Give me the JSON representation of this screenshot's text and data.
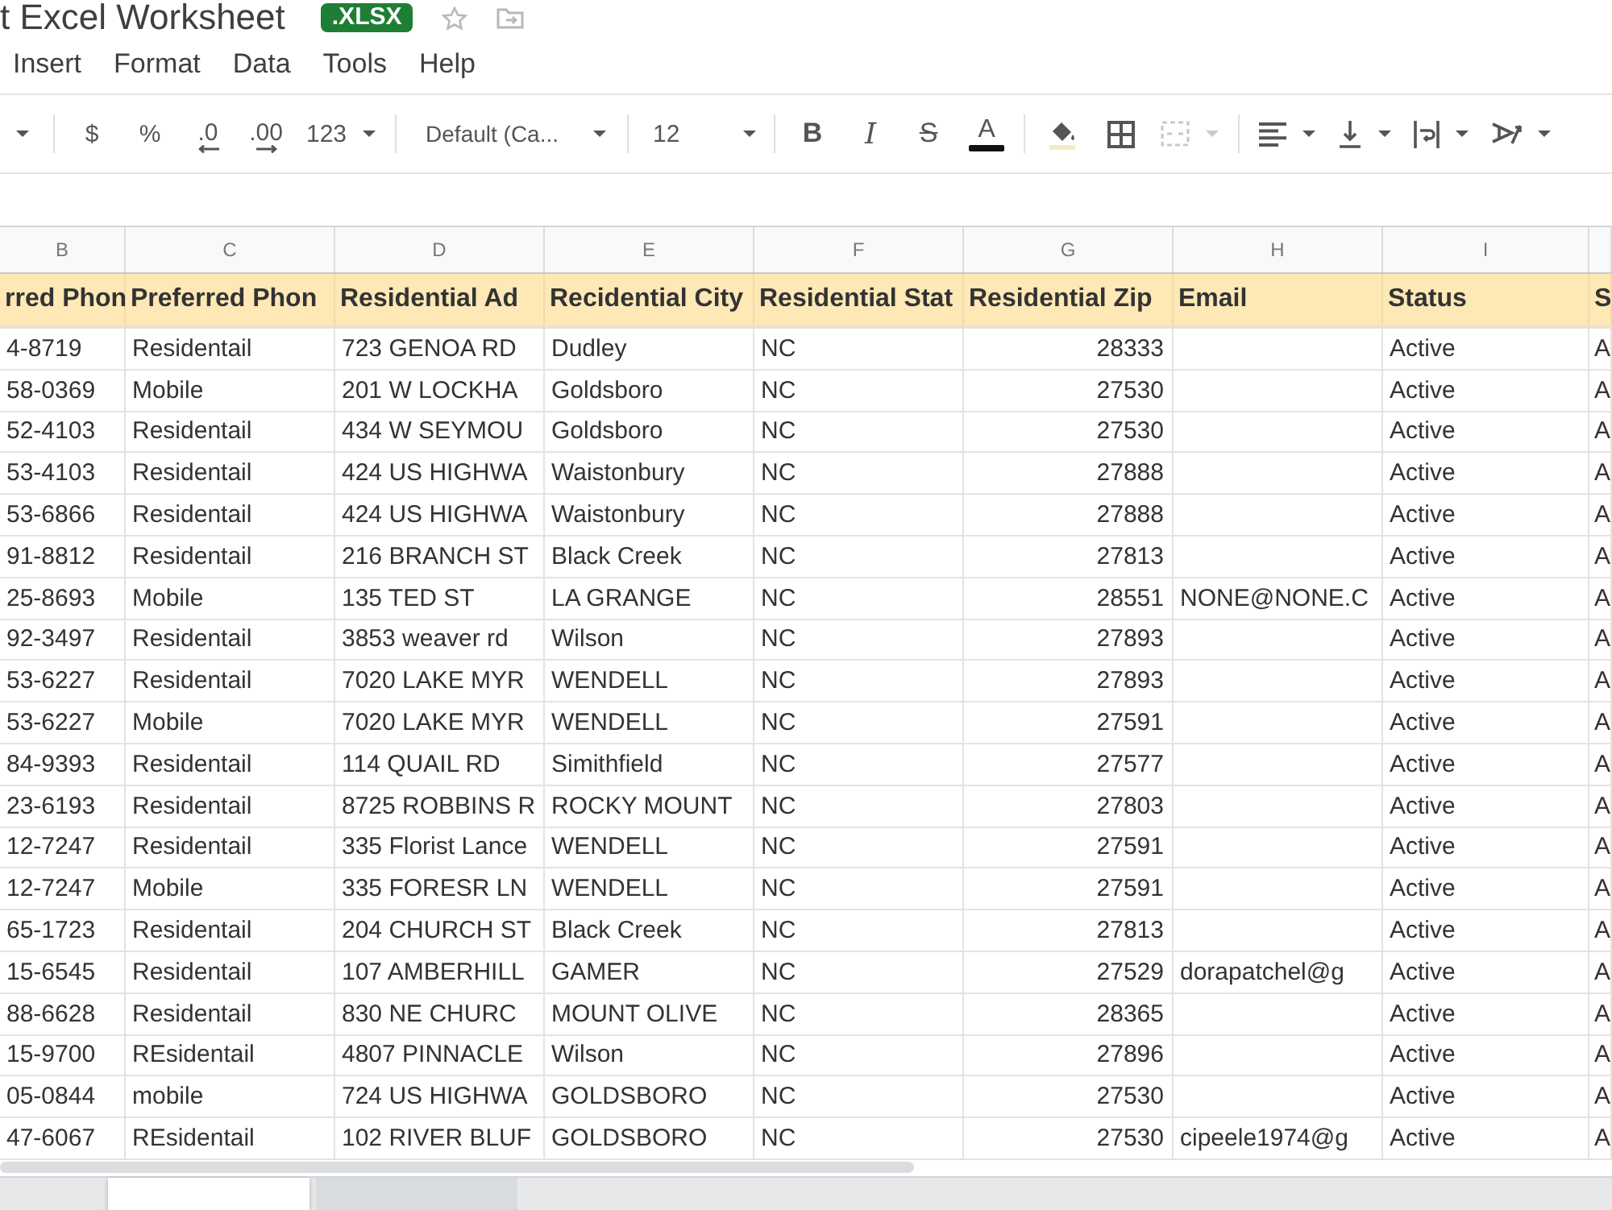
{
  "title": {
    "text": "t Excel Worksheet",
    "badge": ".XLSX"
  },
  "menu": [
    "Insert",
    "Format",
    "Data",
    "Tools",
    "Help"
  ],
  "toolbar": [
    [
      {
        "kind": "caret",
        "menu": true,
        "disabled": false
      }
    ],
    [
      {
        "kind": "text",
        "label": "$",
        "menu": false,
        "disabled": false
      },
      {
        "kind": "text",
        "label": "%",
        "menu": false,
        "disabled": false
      },
      {
        "kind": "decimal-less",
        "label": ".0",
        "menu": false,
        "disabled": false
      },
      {
        "kind": "decimal-more",
        "label": ".00",
        "menu": false,
        "disabled": false
      },
      {
        "kind": "text",
        "label": "123",
        "menu": true,
        "disabled": false
      }
    ],
    [
      {
        "kind": "font",
        "label": "Default (Ca...",
        "menu": true,
        "disabled": false
      }
    ],
    [
      {
        "kind": "size",
        "label": "12",
        "menu": true,
        "disabled": false
      }
    ],
    [
      {
        "kind": "bold",
        "label": "B",
        "menu": false,
        "disabled": false
      },
      {
        "kind": "italic",
        "label": "I",
        "menu": false,
        "disabled": false
      },
      {
        "kind": "strike",
        "label": "S",
        "menu": false,
        "disabled": false
      },
      {
        "kind": "text-color",
        "label": "A",
        "menu": false,
        "disabled": false
      }
    ],
    [
      {
        "kind": "fill",
        "menu": false,
        "disabled": false
      },
      {
        "kind": "borders",
        "menu": false,
        "disabled": false
      },
      {
        "kind": "merge",
        "menu": true,
        "disabled": true
      }
    ],
    [
      {
        "kind": "align",
        "menu": true,
        "disabled": false
      },
      {
        "kind": "valign",
        "menu": true,
        "disabled": false
      },
      {
        "kind": "wrap",
        "menu": true,
        "disabled": false
      },
      {
        "kind": "rotate",
        "menu": true,
        "disabled": false
      }
    ]
  ],
  "sheet": {
    "column_letters": [
      "B",
      "C",
      "D",
      "E",
      "F",
      "G",
      "H",
      "I"
    ],
    "header_row": {
      "b": "rred Phon",
      "c": "Preferred Phon",
      "d": "Residential Ad",
      "e": "Recidential City",
      "f": "Residential Stat",
      "g": "Residential Zip",
      "h": "Email",
      "i": "Status",
      "column_10": "S"
    },
    "rows": [
      {
        "b": "4-8719",
        "c": "Residentail",
        "d": "723 GENOA RD",
        "e": "Dudley",
        "f": "NC",
        "g": "28333",
        "i": "Active",
        "column_10": "A"
      },
      {
        "b": "58-0369",
        "c": "Mobile",
        "d": "201 W LOCKHA",
        "e": "Goldsboro",
        "f": "NC",
        "g": "27530",
        "i": "Active",
        "column_10": "A"
      },
      {
        "b": "52-4103",
        "c": "Residentail",
        "d": "434 W SEYMOU",
        "e": "Goldsboro",
        "f": "NC",
        "g": "27530",
        "i": "Active",
        "column_10": "A"
      },
      {
        "b": "53-4103",
        "c": "Residentail",
        "d": "424 US HIGHWA",
        "e": "Waistonbury",
        "f": "NC",
        "g": "27888",
        "i": "Active",
        "column_10": "A"
      },
      {
        "b": "53-6866",
        "c": "Residentail",
        "d": "424 US HIGHWA",
        "e": "Waistonbury",
        "f": "NC",
        "g": "27888",
        "i": "Active",
        "column_10": "A"
      },
      {
        "b": "91-8812",
        "c": "Residentail",
        "d": "216 BRANCH ST",
        "e": "Black Creek",
        "f": "NC",
        "g": "27813",
        "i": "Active",
        "column_10": "A"
      },
      {
        "b": "25-8693",
        "c": "Mobile",
        "d": "135 TED ST",
        "e": "LA GRANGE",
        "f": "NC",
        "g": "28551",
        "h": "NONE@NONE.C",
        "i": "Active",
        "column_10": "A"
      },
      {
        "b": "92-3497",
        "c": "Residentail",
        "d": "3853 weaver rd",
        "e": "Wilson",
        "f": "NC",
        "g": "27893",
        "i": "Active",
        "column_10": "A"
      },
      {
        "b": "53-6227",
        "c": "Residentail",
        "d": "7020 LAKE MYR",
        "e": "WENDELL",
        "f": "NC",
        "g": "27893",
        "i": "Active",
        "column_10": "A"
      },
      {
        "b": "53-6227",
        "c": "Mobile",
        "d": "7020 LAKE MYR",
        "e": "WENDELL",
        "f": "NC",
        "g": "27591",
        "i": "Active",
        "column_10": "A"
      },
      {
        "b": "84-9393",
        "c": "Residentail",
        "d": "114 QUAIL RD",
        "e": "Simithfield",
        "f": "NC",
        "g": "27577",
        "i": "Active",
        "column_10": "A"
      },
      {
        "b": "23-6193",
        "c": "Residentail",
        "d": "8725 ROBBINS R",
        "e": "ROCKY MOUNT",
        "f": "NC",
        "g": "27803",
        "i": "Active",
        "column_10": "A"
      },
      {
        "b": "12-7247",
        "c": "Residentail",
        "d": "335 Florist Lance",
        "e": "WENDELL",
        "f": "NC",
        "g": "27591",
        "i": "Active",
        "column_10": "A"
      },
      {
        "b": "12-7247",
        "c": "Mobile",
        "d": "335 FORESR LN",
        "e": "WENDELL",
        "f": "NC",
        "g": "27591",
        "i": "Active",
        "column_10": "A"
      },
      {
        "b": "65-1723",
        "c": "Residentail",
        "d": "204 CHURCH ST",
        "e": "Black Creek",
        "f": "NC",
        "g": "27813",
        "i": "Active",
        "column_10": "A"
      },
      {
        "b": "15-6545",
        "c": "Residentail",
        "d": "107 AMBERHILL",
        "e": "GAMER",
        "f": "NC",
        "g": "27529",
        "h": "dorapatchel@g",
        "i": "Active",
        "column_10": "A"
      },
      {
        "b": "88-6628",
        "c": "Residentail",
        "d": "830 NE CHURC",
        "e": "MOUNT OLIVE",
        "f": "NC",
        "g": "28365",
        "i": "Active",
        "column_10": "A"
      },
      {
        "b": "15-9700",
        "c": "REsidentail",
        "d": "4807 PINNACLE",
        "e": "Wilson",
        "f": "NC",
        "g": "27896",
        "i": "Active",
        "column_10": "A"
      },
      {
        "b": "05-0844",
        "c": "mobile",
        "d": "724 US HIGHWA",
        "e": "GOLDSBORO",
        "f": "NC",
        "g": "27530",
        "i": "Active",
        "column_10": "A"
      },
      {
        "b": "47-6067",
        "c": "REsidentail",
        "d": "102 RIVER BLUF",
        "e": "GOLDSBORO",
        "f": "NC",
        "g": "27530",
        "h": "cipeele1974@g",
        "i": "Active",
        "column_10": "A"
      }
    ]
  },
  "sheet_tabs": [
    {
      "selected": true
    },
    {
      "selected": false
    }
  ]
}
